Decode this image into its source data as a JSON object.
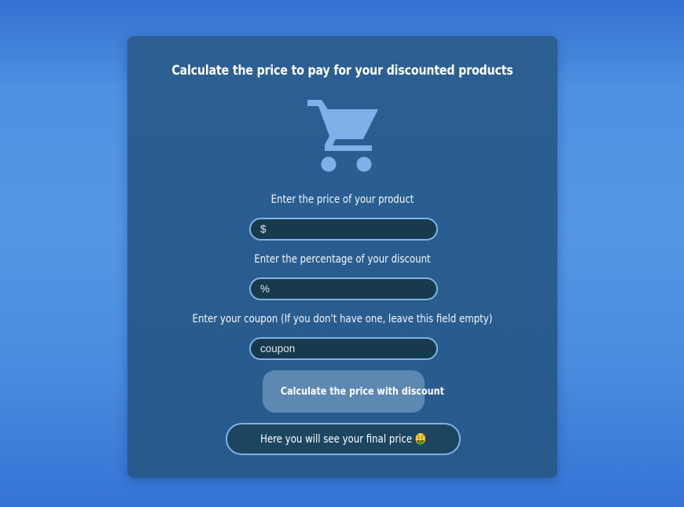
{
  "card": {
    "title": "Calculate the price to pay for your discounted products"
  },
  "icons": {
    "cart": "shopping-cart-icon"
  },
  "form": {
    "price_label": "Enter the price of your product",
    "price_placeholder": "$",
    "discount_label": "Enter the percentage of your discount",
    "discount_placeholder": "%",
    "coupon_label": "Enter your coupon (If you don't have one, leave this field empty)",
    "coupon_placeholder": "coupon"
  },
  "actions": {
    "calculate_label": "Calculate the price with discount"
  },
  "result": {
    "text": "Here you will see your final price",
    "emoji": "🤑"
  },
  "colors": {
    "background": "#4d92e2",
    "card": "#2a5d8f",
    "input_bg": "#173a4c",
    "input_border": "#7fb2e8",
    "button": "#5d88b2",
    "cart_icon": "#7fb0ea"
  }
}
